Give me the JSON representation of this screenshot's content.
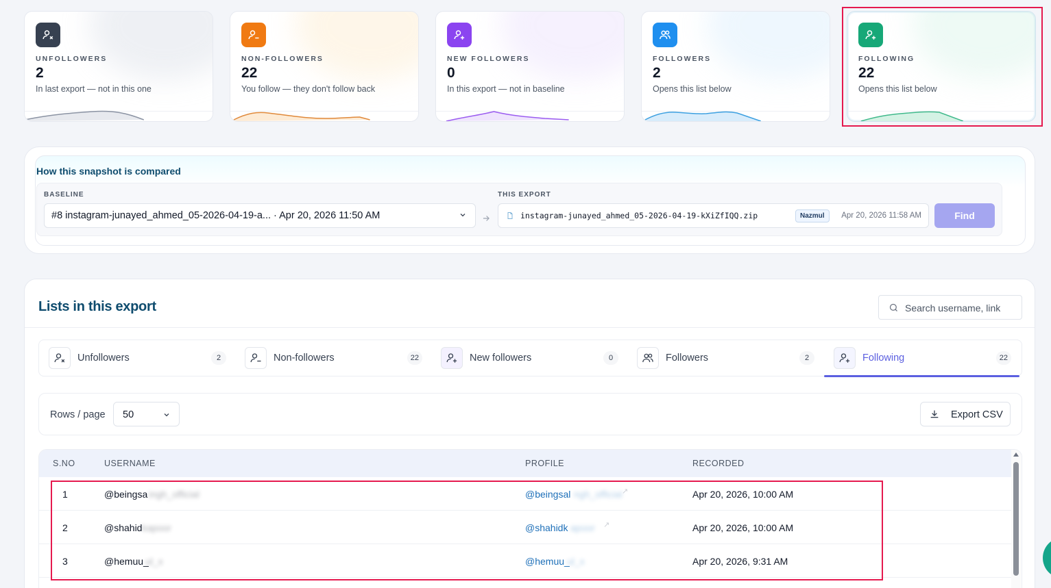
{
  "cards": [
    {
      "label": "UNFOLLOWERS",
      "value": "2",
      "sub": "In last export — not in this one",
      "color": "#374151",
      "icon": "user-x-icon",
      "spark": "#8b93a3"
    },
    {
      "label": "NON-FOLLOWERS",
      "value": "22",
      "sub": "You follow — they don't follow back",
      "color": "#f07a12",
      "icon": "user-minus-icon",
      "spark": "#e0893a"
    },
    {
      "label": "NEW FOLLOWERS",
      "value": "0",
      "sub": "In this export — not in baseline",
      "color": "#8b44f0",
      "icon": "user-plus-icon",
      "spark": "#9b5cf0"
    },
    {
      "label": "FOLLOWERS",
      "value": "2",
      "sub": "Opens this list below",
      "color": "#1f8fef",
      "icon": "users-icon",
      "spark": "#3b9fe0"
    },
    {
      "label": "FOLLOWING",
      "value": "22",
      "sub": "Opens this list below",
      "color": "#17a878",
      "icon": "user-plus-icon",
      "spark": "#3fb98b"
    }
  ],
  "snapshot": {
    "title": "How this snapshot is compared",
    "baseline_label": "BASELINE",
    "baseline_value": "#8 instagram-junayed_ahmed_05-2026-04-19-a... · Apr 20, 2026 11:50 AM",
    "export_label": "THIS EXPORT",
    "export_file": "instagram-junayed_ahmed_05-2026-04-19-kXiZfIQQ.zip",
    "export_tag": "Nazmul",
    "export_date": "Apr 20, 2026 11:58 AM",
    "find_label": "Find"
  },
  "lists": {
    "title": "Lists in this export",
    "search_placeholder": "Search username, link",
    "tabs": [
      {
        "label": "Unfollowers",
        "count": "2",
        "icon": "user-x-icon"
      },
      {
        "label": "Non-followers",
        "count": "22",
        "icon": "user-minus-icon"
      },
      {
        "label": "New followers",
        "count": "0",
        "icon": "user-plus-icon"
      },
      {
        "label": "Followers",
        "count": "2",
        "icon": "users-icon"
      },
      {
        "label": "Following",
        "count": "22",
        "icon": "user-plus-icon",
        "active": true
      }
    ],
    "rows_label": "Rows / page",
    "rows_value": "50",
    "export_csv": "Export CSV",
    "columns": [
      "S.NO",
      "USERNAME",
      "PROFILE",
      "RECORDED"
    ],
    "rows": [
      {
        "sno": "1",
        "username": "@beingsa",
        "profile": "@beingsal",
        "recorded": "Apr 20, 2026, 10:00 AM"
      },
      {
        "sno": "2",
        "username": "@shahid",
        "profile": "@shahidk",
        "recorded": "Apr 20, 2026, 10:00 AM"
      },
      {
        "sno": "3",
        "username": "@hemuu_",
        "profile": "@hemuu_",
        "recorded": "Apr 20, 2026, 9:31 AM"
      }
    ]
  }
}
